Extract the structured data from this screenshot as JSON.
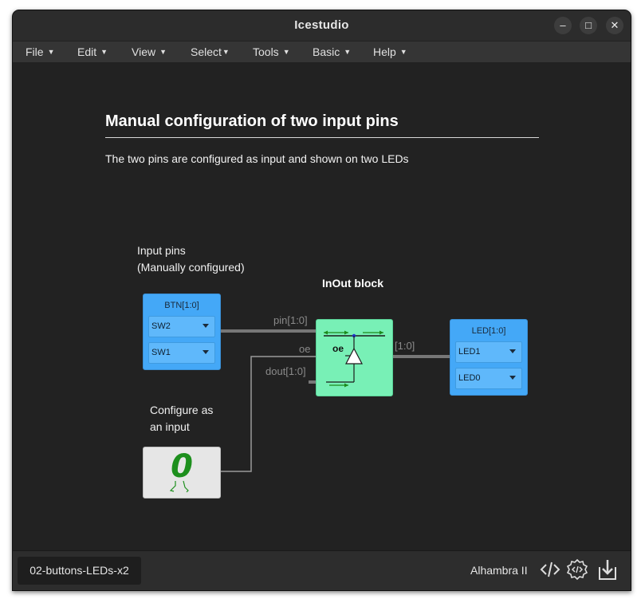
{
  "window": {
    "title": "Icestudio",
    "controls": {
      "minimize": "–",
      "maximize": "□",
      "close": "✕"
    }
  },
  "menu": [
    {
      "label": "File"
    },
    {
      "label": "Edit"
    },
    {
      "label": "View"
    },
    {
      "label": "Select"
    },
    {
      "label": "Tools"
    },
    {
      "label": "Basic"
    },
    {
      "label": "Help"
    }
  ],
  "info": {
    "title": "Manual configuration of two input pins",
    "description": "The two pins are configured as input and shown on two LEDs"
  },
  "comments": {
    "input_pins_line1": "Input pins",
    "input_pins_line2": "(Manually configured)",
    "configure_line1": "Configure as",
    "configure_line2": "an input"
  },
  "blocks": {
    "inout_label": "InOut block",
    "btn": {
      "title": "BTN[1:0]",
      "pins": [
        "SW2",
        "SW1"
      ]
    },
    "led": {
      "title": "LED[1:0]",
      "pins": [
        "LED1",
        "LED0"
      ]
    },
    "inout_port": "oe",
    "constant_value": "0"
  },
  "wires": {
    "pin": "pin[1:0]",
    "oe": "oe",
    "dout": "dout[1:0]",
    "bus": "[1:0]"
  },
  "status": {
    "file_name": "02-buttons-LEDs-x2",
    "board": "Alhambra II",
    "icons": [
      "code-icon",
      "settings-code-icon",
      "download-icon"
    ]
  },
  "colors": {
    "canvas": "#222222",
    "pin_block": "#44a8f7",
    "inout_block": "#78f0b6",
    "constant_block": "#e6e6e6",
    "wire": "#777777"
  }
}
